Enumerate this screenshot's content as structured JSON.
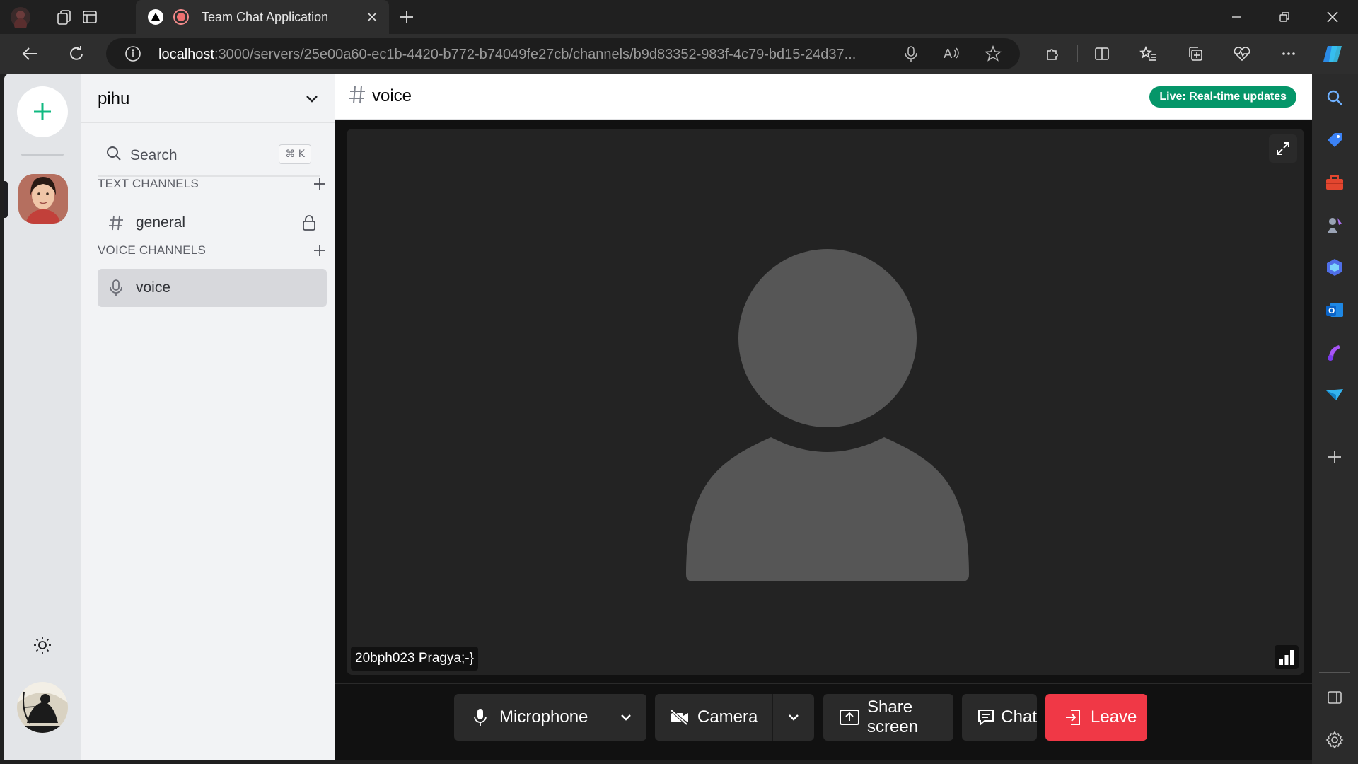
{
  "browser": {
    "tab_title": "Team Chat Application",
    "url_host": "localhost",
    "url_path": ":3000/servers/25e00a60-ec1b-4420-b772-b74049fe27cb/channels/b9d83352-983f-4c79-bd15-24d37..."
  },
  "server": {
    "name": "pihu",
    "search_label": "Search",
    "search_shortcut": "⌘ K",
    "text_section": "TEXT CHANNELS",
    "voice_section": "VOICE CHANNELS",
    "text_channels": [
      {
        "name": "general",
        "locked": true
      }
    ],
    "voice_channels": [
      {
        "name": "voice",
        "active": true
      }
    ]
  },
  "channel": {
    "name": "voice",
    "live_badge": "Live: Real-time updates"
  },
  "call": {
    "participant_name": "20bph023 Pragya;-}",
    "controls": {
      "microphone": "Microphone",
      "camera": "Camera",
      "share_screen": "Share screen",
      "chat": "Chat",
      "leave": "Leave"
    }
  },
  "colors": {
    "live": "#059669",
    "leave": "#f03846",
    "add_server": "#10b981"
  }
}
